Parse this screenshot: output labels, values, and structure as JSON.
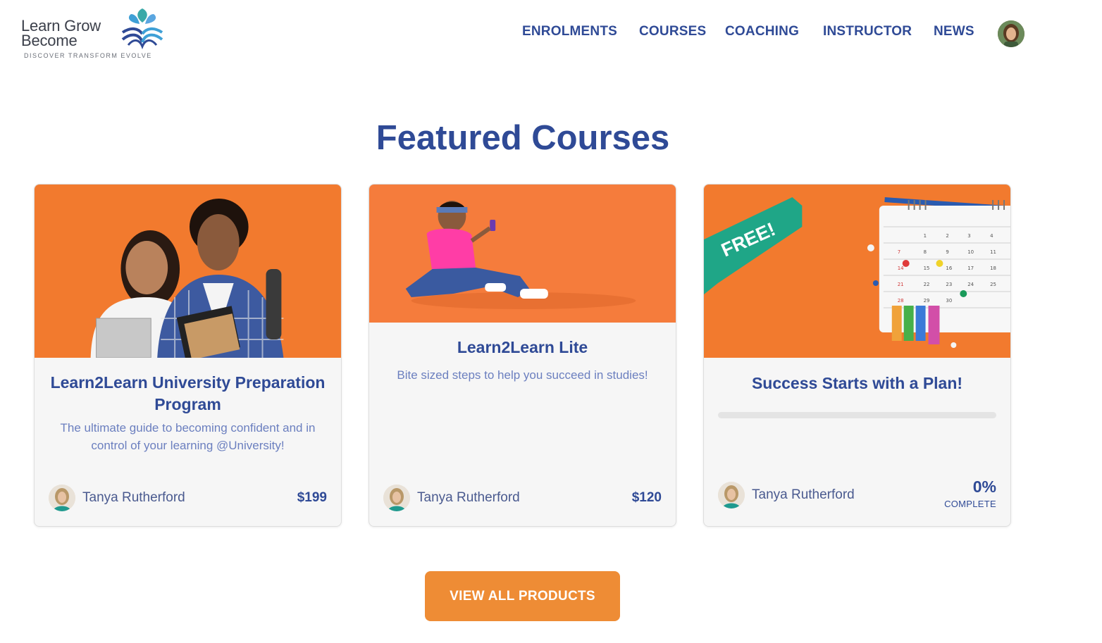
{
  "brand": {
    "line1": "Learn Grow",
    "line2": "Become",
    "tagline": "DISCOVER  TRANSFORM  EVOLVE"
  },
  "nav": {
    "items": [
      {
        "label": "ENROLMENTS"
      },
      {
        "label": "COURSES"
      },
      {
        "label": "COACHING"
      },
      {
        "label": "INSTRUCTOR"
      },
      {
        "label": "NEWS"
      }
    ],
    "avatar_icon": "user-avatar"
  },
  "main": {
    "title": "Featured Courses",
    "cards": [
      {
        "title": "Learn2Learn University Preparation Program",
        "description": "The ultimate guide to becoming confident and in control of your learning @University!",
        "author": "Tanya Rutherford",
        "price": "$199",
        "image_icon": "students-photo"
      },
      {
        "title": "Learn2Learn Lite",
        "description": "Bite sized steps to help you succeed in studies!",
        "author": "Tanya Rutherford",
        "price": "$120",
        "image_icon": "student-phone-photo"
      },
      {
        "title": "Success Starts with a Plan!",
        "badge": "FREE!",
        "author": "Tanya Rutherford",
        "progress_fraction": 0,
        "progress_value": "0%",
        "progress_label": "COMPLETE",
        "image_icon": "calendar-photo"
      }
    ],
    "calendar_numbers": [
      "1",
      "2",
      "3",
      "4",
      "7",
      "8",
      "9",
      "10",
      "11",
      "14",
      "15",
      "16",
      "17",
      "18",
      "21",
      "22",
      "23",
      "24",
      "25",
      "28",
      "29",
      "30"
    ]
  },
  "cta": {
    "label": "VIEW ALL PRODUCTS"
  },
  "colors": {
    "primary": "#2f4a96",
    "accent_orange": "#ee8c35",
    "image_orange": "#f27a2e",
    "free_badge": "#1fa687",
    "card_bg": "#f6f6f6"
  }
}
